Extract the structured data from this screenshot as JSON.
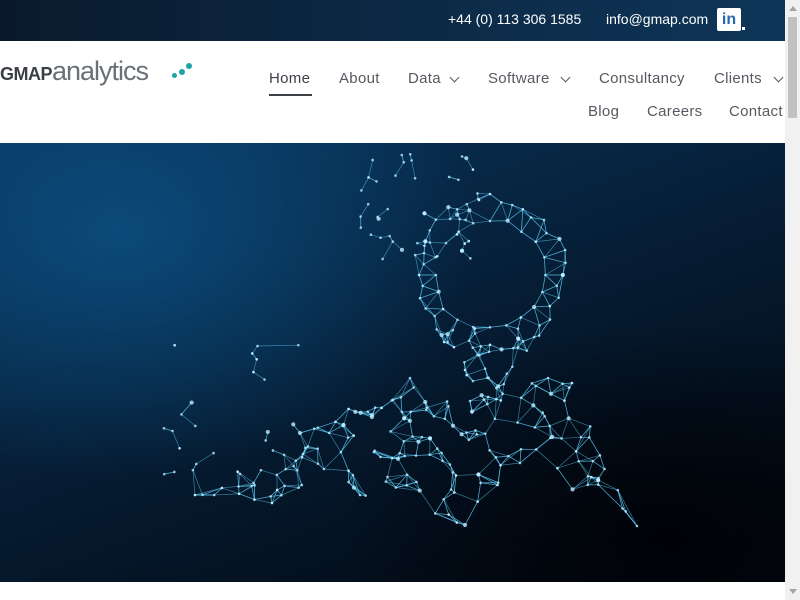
{
  "topbar": {
    "phone": "+44 (0) 113 306 1585",
    "email": "info@gmap.com",
    "linkedin_icon": "linkedin-icon",
    "linkedin_label": "in"
  },
  "logo": {
    "part1": "GMAP",
    "part2": "analytics"
  },
  "nav": {
    "home": "Home",
    "about": "About",
    "data": "Data",
    "software": "Software",
    "consultancy": "Consultancy",
    "clients": "Clients",
    "blog": "Blog",
    "careers": "Careers",
    "contact": "Contact"
  },
  "hero": {
    "image": "map-pin-network-illustration"
  },
  "colors": {
    "topbar": "#0c2a47",
    "accent": "#1aa3a8",
    "hero_glow": "#5fd4ff"
  }
}
